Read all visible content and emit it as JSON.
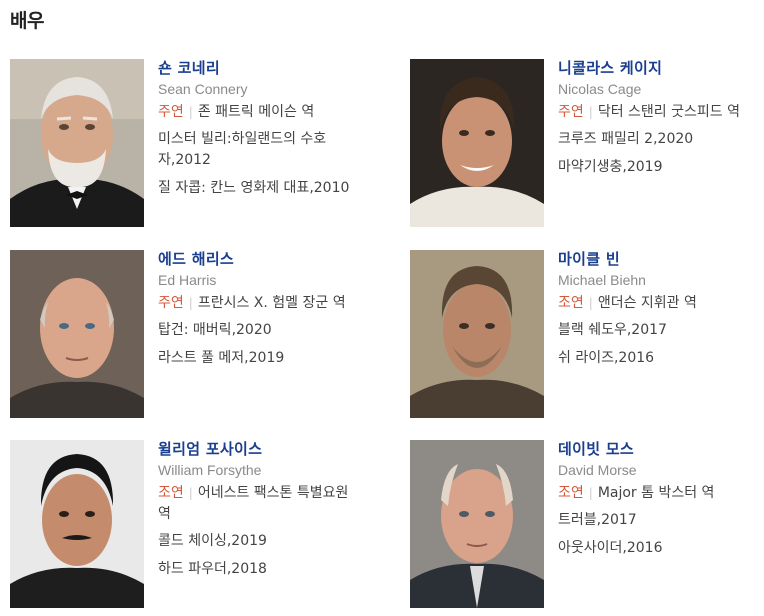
{
  "section": {
    "title": "배우"
  },
  "actors": [
    {
      "name": "숀 코네리",
      "name_en": "Sean Connery",
      "role_type": "주연",
      "role": "존 패트릭 메이슨 역",
      "films": [
        "미스터 빌리:하일랜드의 수호자,2012",
        "질 자콥: 칸느 영화제 대표,2010"
      ]
    },
    {
      "name": "니콜라스 케이지",
      "name_en": "Nicolas Cage",
      "role_type": "주연",
      "role": "닥터 스탠리 굿스피드 역",
      "films": [
        "크루즈 패밀리 2,2020",
        "마약기생충,2019"
      ]
    },
    {
      "name": "에드 해리스",
      "name_en": "Ed Harris",
      "role_type": "주연",
      "role": "프란시스 X. 험멜 장군 역",
      "films": [
        "탑건: 매버릭,2020",
        "라스트 풀 메저,2019"
      ]
    },
    {
      "name": "마이클 빈",
      "name_en": "Michael Biehn",
      "role_type": "조연",
      "role": "앤더슨 지휘관 역",
      "films": [
        "블랙 쉐도우,2017",
        "쉬 라이즈,2016"
      ]
    },
    {
      "name": "윌리엄 포사이스",
      "name_en": "William Forsythe",
      "role_type": "조연",
      "role": "어네스트 팩스톤 특별요원 역",
      "films": [
        "콜드 체이싱,2019",
        "하드 파우더,2018"
      ]
    },
    {
      "name": "데이빗 모스",
      "name_en": "David Morse",
      "role_type": "조연",
      "role": "Major 톰 박스터 역",
      "films": [
        "트러블,2017",
        "아웃사이더,2016"
      ]
    }
  ],
  "colors": {
    "name_link": "#1a3f8f",
    "role_type": "#d35a3c",
    "english_name": "#8a8a8a",
    "body_text": "#444444"
  }
}
